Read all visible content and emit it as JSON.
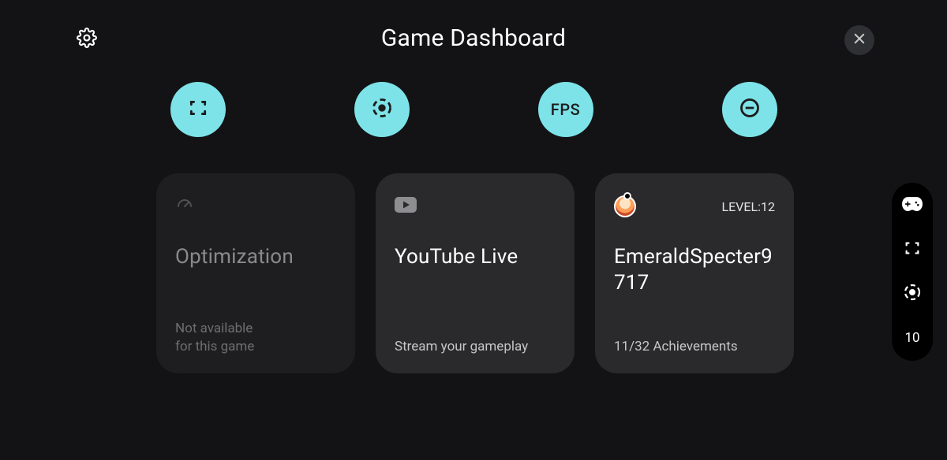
{
  "header": {
    "title": "Game Dashboard"
  },
  "quick_actions": {
    "screenshot": {
      "icon": "screenshot"
    },
    "record": {
      "icon": "record"
    },
    "fps": {
      "label": "FPS"
    },
    "dnd": {
      "icon": "do-not-disturb"
    }
  },
  "cards": {
    "optimization": {
      "title": "Optimization",
      "subtitle": "Not available\nfor this game"
    },
    "youtube": {
      "title": "YouTube Live",
      "subtitle": "Stream your gameplay"
    },
    "profile": {
      "username": "EmeraldSpecter9717",
      "level_label": "LEVEL:12",
      "achievements": "11/32 Achievements"
    }
  },
  "rail": {
    "fps_value": "10"
  }
}
